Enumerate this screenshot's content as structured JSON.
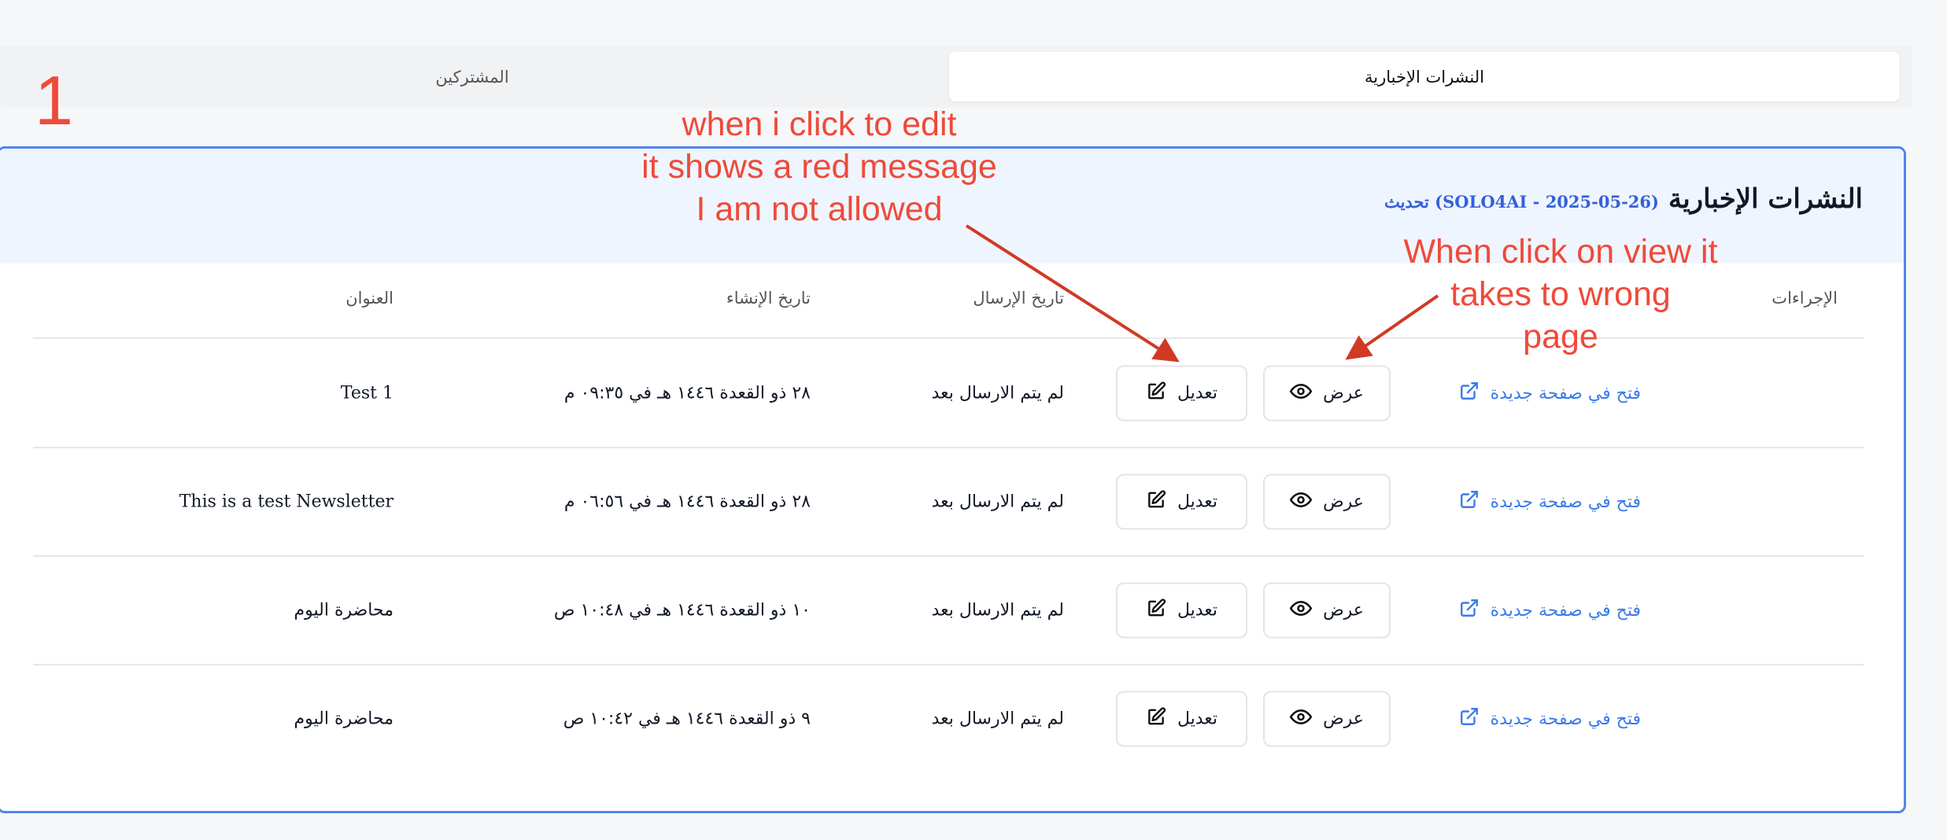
{
  "tabs": {
    "active": "النشرات الإخبارية",
    "other": "المشتركين"
  },
  "annotation_number": "1",
  "card": {
    "title": "النشرات الإخبارية",
    "subtitle": "(SOLO4AI - 2025-05-26) تحديث"
  },
  "table": {
    "headers": {
      "title": "العنوان",
      "created": "تاريخ الإنشاء",
      "sent": "تاريخ الإرسال",
      "actions": "الإجراءات"
    },
    "rows": [
      {
        "title": "Test 1",
        "created": "٢٨ ذو القعدة ١٤٤٦ هـ في ٠٩:٣٥ م",
        "sent": "لم يتم الارسال بعد",
        "edit": "تعديل",
        "view": "عرض",
        "open": "فتح في صفحة جديدة"
      },
      {
        "title": "This is a test Newsletter",
        "created": "٢٨ ذو القعدة ١٤٤٦ هـ في ٠٦:٥٦ م",
        "sent": "لم يتم الارسال بعد",
        "edit": "تعديل",
        "view": "عرض",
        "open": "فتح في صفحة جديدة"
      },
      {
        "title": "محاضرة اليوم",
        "created": "١٠ ذو القعدة ١٤٤٦ هـ في ١٠:٤٨ ص",
        "sent": "لم يتم الارسال بعد",
        "edit": "تعديل",
        "view": "عرض",
        "open": "فتح في صفحة جديدة"
      },
      {
        "title": "محاضرة اليوم",
        "created": "٩ ذو القعدة ١٤٤٦ هـ في ١٠:٤٢ ص",
        "sent": "لم يتم الارسال بعد",
        "edit": "تعديل",
        "view": "عرض",
        "open": "فتح في صفحة جديدة"
      }
    ]
  },
  "annotations": {
    "edit_note": [
      "when i click to edit",
      "it shows a red message",
      "I am not allowed"
    ],
    "view_note": [
      "When click on view it",
      "takes to wrong",
      "page"
    ]
  },
  "colors": {
    "accent": "#3b7be9",
    "card_border": "#4f86ec",
    "annotation": "#ef4a3a",
    "arrow": "#d03a25"
  },
  "icons": {
    "edit": "pencil-square-icon",
    "view": "eye-icon",
    "open": "external-link-icon"
  }
}
